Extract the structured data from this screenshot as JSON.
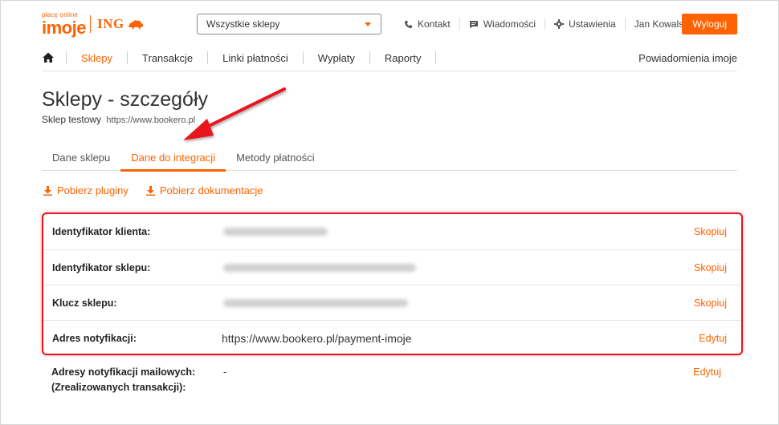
{
  "logo": {
    "tagline": "płacę online",
    "word": "imoje",
    "bank": "ING"
  },
  "shop_select": {
    "value": "Wszystkie sklepy"
  },
  "toplinks": [
    {
      "label": "Kontakt",
      "icon": "phone-icon"
    },
    {
      "label": "Wiadomości",
      "icon": "message-icon"
    },
    {
      "label": "Ustawienia",
      "icon": "gear-icon"
    },
    {
      "label": "Jan Kowalski",
      "icon": ""
    }
  ],
  "logout_label": "Wyloguj",
  "nav": {
    "items": [
      "Sklepy",
      "Transakcje",
      "Linki płatności",
      "Wypłaty",
      "Raporty"
    ],
    "active": "Sklepy",
    "right": "Powiadomienia imoje"
  },
  "page": {
    "title": "Sklepy - szczegóły",
    "subtitle_label": "Sklep testowy",
    "subtitle_url": "https://www.bookero.pl"
  },
  "tabs": [
    "Dane sklepu",
    "Dane do integracji",
    "Metody płatności"
  ],
  "active_tab": "Dane do integracji",
  "downloads": [
    "Pobierz pluginy",
    "Pobierz dokumentacje"
  ],
  "rows": [
    {
      "label": "Identyfikator klienta:",
      "value": "",
      "action": "Skopiuj"
    },
    {
      "label": "Identyfikator sklepu:",
      "value": "",
      "action": "Skopiuj"
    },
    {
      "label": "Klucz sklepu:",
      "value": "",
      "action": "Skopiuj"
    },
    {
      "label": "Adres notyfikacji:",
      "value": "https://www.bookero.pl/payment-imoje",
      "action": "Edytuj"
    }
  ],
  "mail_row": {
    "label_line1": "Adresy notyfikacji mailowych:",
    "label_line2": "(Zrealizowanych transakcji):",
    "value": "-",
    "action": "Edytuj"
  },
  "colors": {
    "accent": "#ff6200",
    "highlight": "#e8131f"
  }
}
